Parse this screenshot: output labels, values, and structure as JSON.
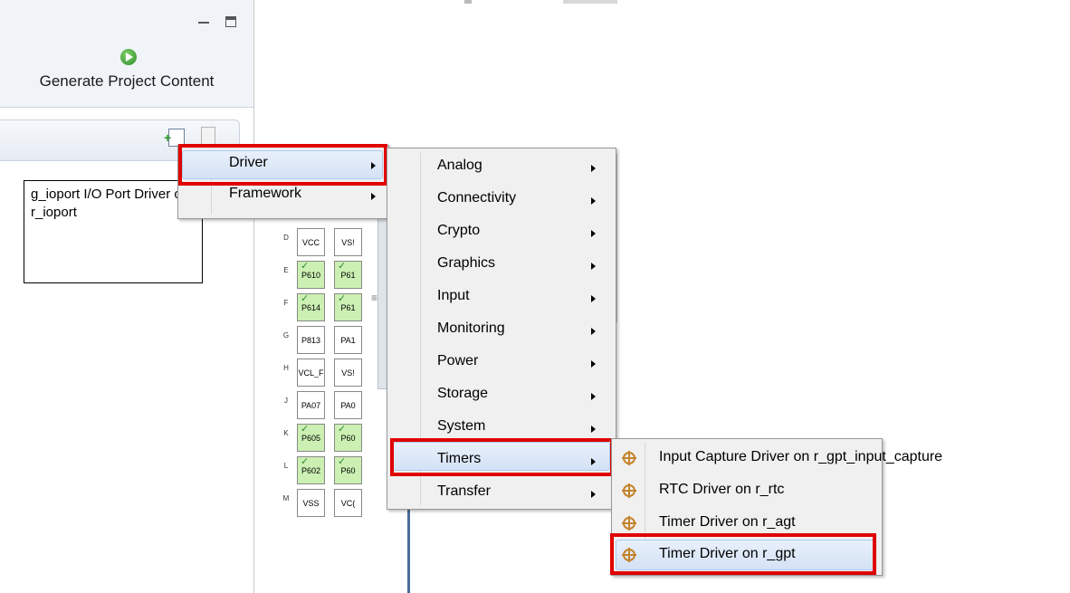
{
  "view": {
    "generate_label": "Generate Project Content",
    "stack_item": "g_ioport I/O Port Driver on r_ioport"
  },
  "pins": {
    "rows": [
      {
        "letter": "D",
        "cells": [
          {
            "label": "VCC",
            "green": false
          },
          {
            "label": "VS!",
            "green": false
          }
        ]
      },
      {
        "letter": "E",
        "cells": [
          {
            "label": "P610",
            "green": true
          },
          {
            "label": "P61",
            "green": true
          }
        ]
      },
      {
        "letter": "F",
        "cells": [
          {
            "label": "P614",
            "green": true
          },
          {
            "label": "P61",
            "green": true
          }
        ]
      },
      {
        "letter": "G",
        "cells": [
          {
            "label": "P813",
            "green": false
          },
          {
            "label": "PA1",
            "green": false
          }
        ]
      },
      {
        "letter": "H",
        "cells": [
          {
            "label": "VCL_F",
            "green": false
          },
          {
            "label": "VS!",
            "green": false
          }
        ]
      },
      {
        "letter": "J",
        "cells": [
          {
            "label": "PA07",
            "green": false
          },
          {
            "label": "PA0",
            "green": false
          }
        ]
      },
      {
        "letter": "K",
        "cells": [
          {
            "label": "P605",
            "green": true
          },
          {
            "label": "P60",
            "green": true
          }
        ]
      },
      {
        "letter": "L",
        "cells": [
          {
            "label": "P602",
            "green": true
          },
          {
            "label": "P60",
            "green": true
          }
        ]
      },
      {
        "letter": "M",
        "cells": [
          {
            "label": "VSS",
            "green": false
          },
          {
            "label": "VC(",
            "green": false
          }
        ]
      }
    ]
  },
  "menu1": {
    "items": [
      {
        "label": "Driver"
      },
      {
        "label": "Framework"
      }
    ]
  },
  "menu2": {
    "items": [
      {
        "label": "Analog"
      },
      {
        "label": "Connectivity"
      },
      {
        "label": "Crypto"
      },
      {
        "label": "Graphics"
      },
      {
        "label": "Input"
      },
      {
        "label": "Monitoring"
      },
      {
        "label": "Power"
      },
      {
        "label": "Storage"
      },
      {
        "label": "System"
      },
      {
        "label": "Timers"
      },
      {
        "label": "Transfer"
      }
    ]
  },
  "menu3": {
    "items": [
      {
        "label": "Input Capture Driver on r_gpt_input_capture",
        "icon": "crosshair-icon"
      },
      {
        "label": "RTC Driver on r_rtc",
        "icon": "crosshair-icon"
      },
      {
        "label": "Timer Driver on r_agt",
        "icon": "crosshair-icon"
      },
      {
        "label": "Timer Driver on r_gpt",
        "icon": "crosshair-icon"
      }
    ]
  },
  "colors": {
    "highlight_box": "#e00000",
    "menu_bg": "#f0f0f0",
    "pin_green": "#ccf0b3"
  }
}
